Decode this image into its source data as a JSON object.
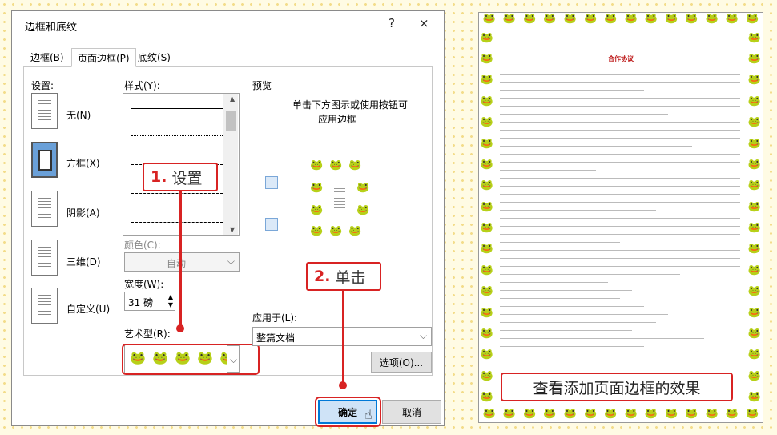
{
  "dialog": {
    "title": "边框和底纹",
    "help": "?",
    "close": "×",
    "tabs": [
      "边框(B)",
      "页面边框(P)",
      "底纹(S)"
    ],
    "settings_label": "设置:",
    "settings": [
      "无(N)",
      "方框(X)",
      "阴影(A)",
      "三维(D)",
      "自定义(U)"
    ],
    "style_label": "样式(Y):",
    "color_label": "颜色(C):",
    "color_value": "自动",
    "width_label": "宽度(W):",
    "width_value": "31 磅",
    "art_label": "艺术型(R):",
    "preview_label": "预览",
    "preview_hint_1": "单击下方图示或使用按钮可",
    "preview_hint_2": "应用边框",
    "apply_label": "应用于(L):",
    "apply_value": "整篇文档",
    "options_button": "选项(O)...",
    "ok_button": "确定",
    "cancel_button": "取消"
  },
  "callouts": {
    "step1_num": "1.",
    "step1_text": "设置",
    "step2_num": "2.",
    "step2_text": "单击"
  },
  "document": {
    "title": "合作协议",
    "caption": "查看添加页面边框的效果"
  },
  "colors": {
    "accent": "#d82323",
    "frog": "#1f9a3a",
    "ok_bg": "#cfe3f7"
  }
}
